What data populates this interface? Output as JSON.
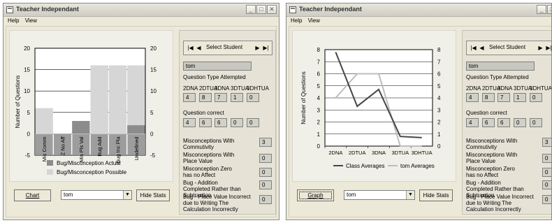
{
  "window_title": "Teacher Independant",
  "menu": [
    "Help",
    "View"
  ],
  "title_buttons": {
    "minimize": "_",
    "maximize": "□",
    "close": "✕"
  },
  "left": {
    "chart_data": {
      "type": "bar",
      "categories": [
        "Mis Comm",
        "Z No Aff",
        "Mis Pls Val",
        "Bug Add",
        "Bug Inc Pla",
        "Undefined"
      ],
      "series": [
        {
          "name": "Bug/Misconception Actual",
          "values": [
            0,
            0,
            3,
            0,
            0,
            2
          ]
        },
        {
          "name": "Bug/Misconception Possible",
          "values": [
            6,
            0,
            0,
            16,
            16,
            16
          ]
        }
      ],
      "ylabel": "Number of Questions",
      "ylim": [
        -5,
        20
      ],
      "yticks": [
        -5,
        0,
        5,
        10,
        15,
        20
      ],
      "legend": [
        "Bug/Misconception Actual",
        "Bug/Misconception Possible"
      ],
      "colors": {
        "actual": "#8c8c8c",
        "possible": "#d6d6d6"
      }
    },
    "chart_button": "Chart",
    "student_combo": "tom",
    "hide_button": "Hide Stats"
  },
  "right": {
    "chart_data": {
      "type": "line",
      "categories": [
        "2DNA",
        "2DTUA",
        "3DNA",
        "3DTUA",
        "3DHTUA"
      ],
      "series": [
        {
          "name": "Class Averages",
          "values": [
            7.8,
            3.3,
            4.7,
            0.8,
            0.7
          ]
        },
        {
          "name": "tom Averages",
          "values": [
            4,
            6,
            6,
            0,
            0
          ]
        }
      ],
      "ylabel": "Number of Questions",
      "ylim": [
        0,
        8
      ],
      "yticks": [
        0,
        1,
        2,
        3,
        4,
        5,
        6,
        7,
        8
      ],
      "legend": [
        "Class Averages",
        "tom Averages"
      ],
      "colors": {
        "class": "#454545",
        "student": "#bdbdbd"
      }
    },
    "graph_button": "Graph",
    "student_combo": "tom",
    "hide_button": "Hide Stats"
  },
  "stats": {
    "select_student": "Select Student",
    "student_name": "tom",
    "qtype_title": "Question Type Attempted",
    "qtype_headers": [
      "2DNA",
      "2DTUA",
      "3DNA",
      "3DTUA",
      "3DHTUA"
    ],
    "attempted": [
      "4",
      "8",
      "7",
      "1",
      "0"
    ],
    "correct_title": "Question correct",
    "correct": [
      "4",
      "6",
      "6",
      "0",
      "0"
    ],
    "misconceptions": [
      {
        "label": "Misconceptions With Commutivity",
        "value": "3"
      },
      {
        "label": "Misconceptions With Place Value",
        "value": "0"
      },
      {
        "label": "Misconception Zero has no Affect",
        "value": "0"
      },
      {
        "label": "Bug - Addition Completed Rather than Subtraction",
        "value": "0"
      },
      {
        "label": "Bug - Place Value Incorrect due to Writing The Calculation Incorrectly",
        "value": "0"
      }
    ]
  }
}
